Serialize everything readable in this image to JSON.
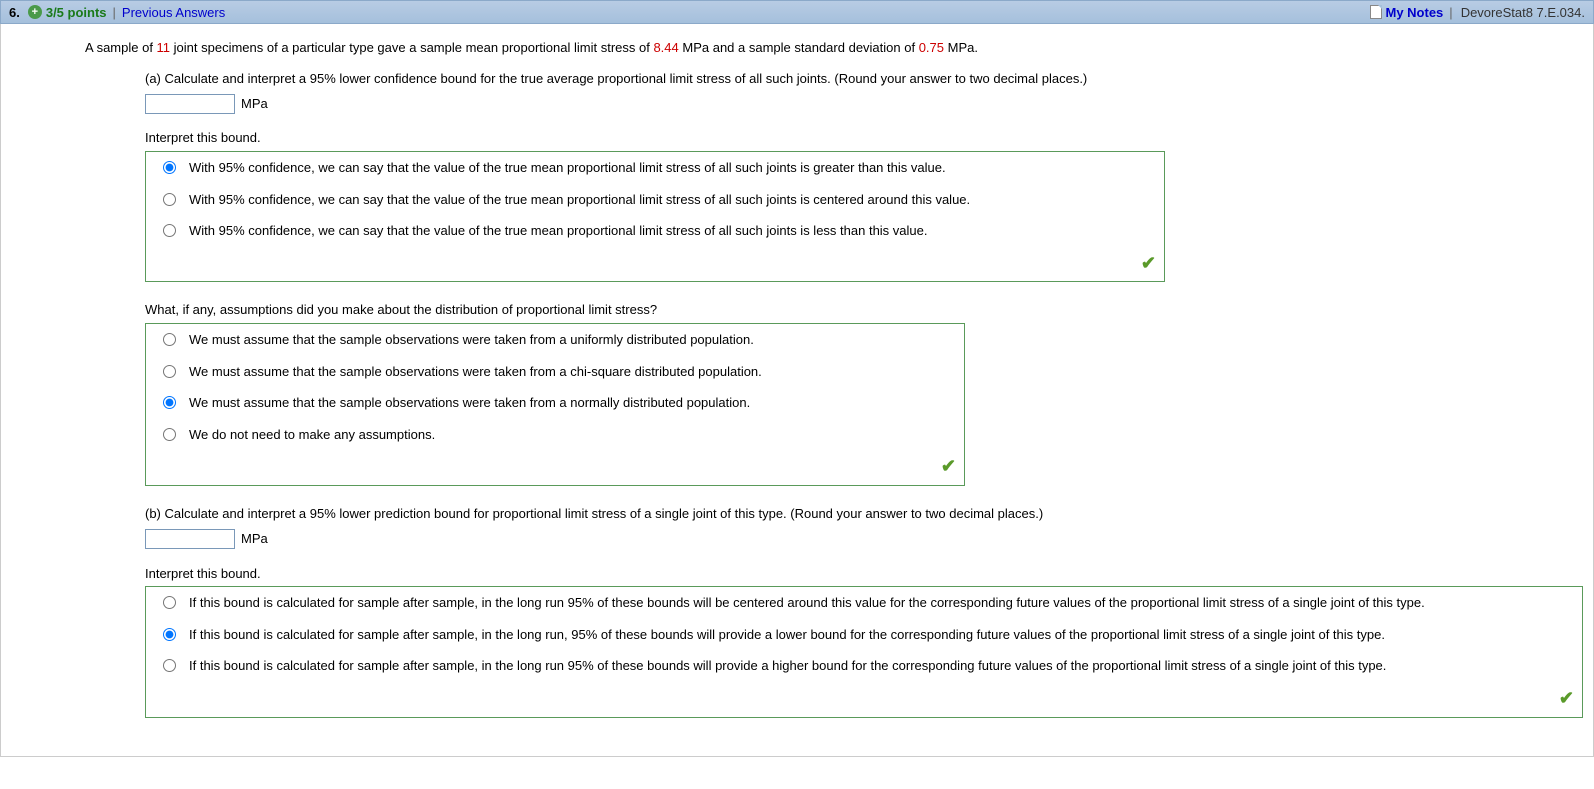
{
  "header": {
    "question_number": "6.",
    "points": "3/5 points",
    "prev_answers": "Previous Answers",
    "my_notes": "My Notes",
    "source": "DevoreStat8 7.E.034."
  },
  "stem": {
    "t1": "A sample of ",
    "n": "11",
    "t2": " joint specimens of a particular type gave a sample mean proportional limit stress of ",
    "mean": "8.44",
    "t3": " MPa and a sample standard deviation of ",
    "sd": "0.75",
    "t4": " MPa."
  },
  "part_a": {
    "prompt": "(a) Calculate and interpret a 95% lower confidence bound for the true average proportional limit stress of all such joints. (Round your answer to two decimal places.)",
    "unit": "MPa",
    "interpret_label": "Interpret this bound.",
    "options": [
      "With 95% confidence, we can say that the value of the true mean proportional limit stress of all such joints is greater than this value.",
      "With 95% confidence, we can say that the value of the true mean proportional limit stress of all such joints is centered around this value.",
      "With 95% confidence, we can say that the value of the true mean proportional limit stress of all such joints is less than this value."
    ],
    "assump_label": "What, if any, assumptions did you make about the distribution of proportional limit stress?",
    "assump_options": [
      "We must assume that the sample observations were taken from a uniformly distributed population.",
      "We must assume that the sample observations were taken from a chi-square distributed population.",
      "We must assume that the sample observations were taken from a normally distributed population.",
      "We do not need to make any assumptions."
    ]
  },
  "part_b": {
    "prompt": "(b) Calculate and interpret a 95% lower prediction bound for proportional limit stress of a single joint of this type. (Round your answer to two decimal places.)",
    "unit": "MPa",
    "interpret_label": "Interpret this bound.",
    "options": [
      "If this bound is calculated for sample after sample, in the long run 95% of these bounds will be centered around this value for the corresponding future values of the proportional limit stress of a single joint of this type.",
      "If this bound is calculated for sample after sample, in the long run, 95% of these bounds will provide a lower bound for the corresponding future values of the proportional limit stress of a single joint of this type.",
      "If this bound is calculated for sample after sample, in the long run 95% of these bounds will provide a higher bound for the corresponding future values of the proportional limit stress of a single joint of this type."
    ]
  }
}
